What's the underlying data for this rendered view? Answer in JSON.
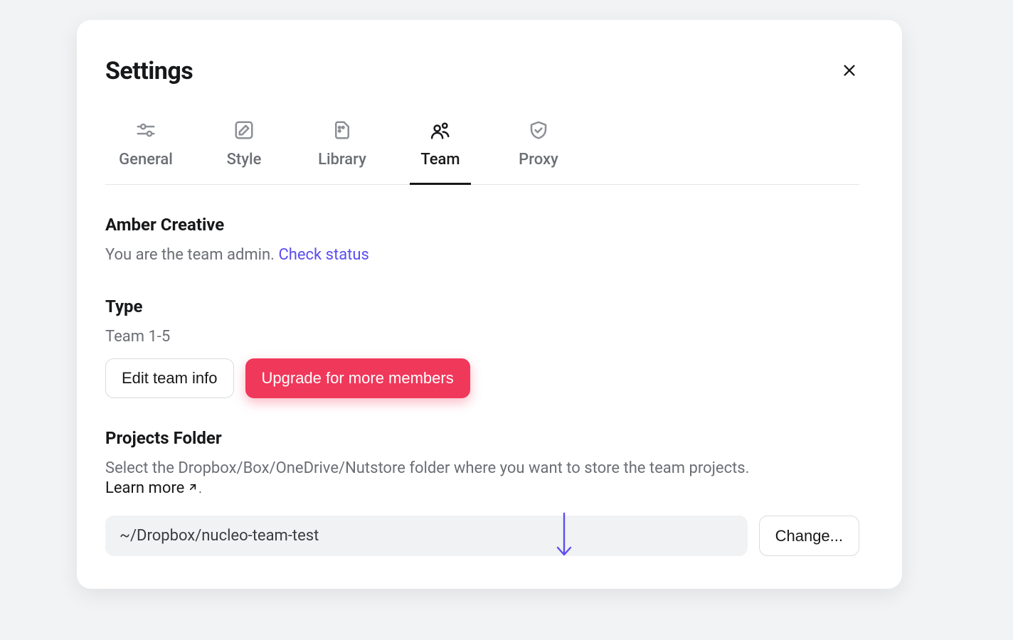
{
  "modal": {
    "title": "Settings",
    "tabs": {
      "general": "General",
      "style": "Style",
      "library": "Library",
      "team": "Team",
      "proxy": "Proxy"
    }
  },
  "team": {
    "name": "Amber Creative",
    "admin_line": "You are the team admin. ",
    "check_status": "Check status",
    "type_heading": "Type",
    "type_value": "Team 1-5",
    "edit_btn": "Edit team info",
    "upgrade_btn": "Upgrade for more members"
  },
  "projects": {
    "heading": "Projects Folder",
    "description": "Select the Dropbox/Box/OneDrive/Nutstore folder where you want to store the team projects.",
    "learn_more": "Learn more",
    "period": ".",
    "path": "~/Dropbox/nucleo-team-test",
    "change_btn": "Change..."
  }
}
